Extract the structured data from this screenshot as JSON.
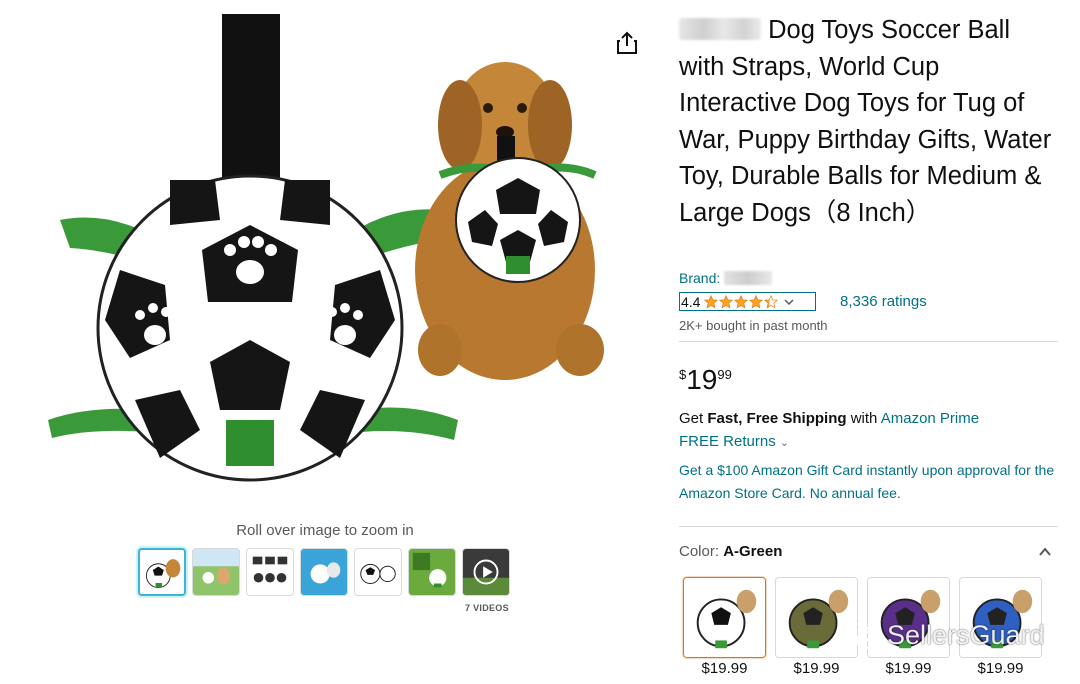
{
  "product": {
    "title": "Dog Toys Soccer Ball with Straps, World Cup Interactive Dog Toys for Tug of War, Puppy Birthday Gifts, Water Toy, Durable Balls for Medium & Large Dogs（8 Inch）",
    "brand_label": "Brand:",
    "rating": {
      "value": "4.4",
      "stars_out_of_5": 4.4,
      "count_label": "8,336 ratings"
    },
    "bought_label": "2K+ bought in past month",
    "price": {
      "symbol": "$",
      "whole": "19",
      "fraction": "99"
    },
    "shipping": {
      "prefix": "Get ",
      "bold": "Fast, Free Shipping",
      "middle": " with ",
      "link": "Amazon Prime"
    },
    "returns_label": "FREE Returns",
    "gift_card_text": "Get a $100 Amazon Gift Card instantly upon approval for the Amazon Store Card. No annual fee.",
    "color": {
      "label": "Color: ",
      "selected": "A-Green"
    },
    "swatches": [
      {
        "name": "A-Green",
        "price": "$19.99",
        "color": "#2f8f2f"
      },
      {
        "name": "Camo",
        "price": "$19.99",
        "color": "#6b6b3a"
      },
      {
        "name": "Purple",
        "price": "$19.99",
        "color": "#5a2f8a"
      },
      {
        "name": "Blue",
        "price": "$19.99",
        "color": "#2f5fc0"
      }
    ]
  },
  "gallery": {
    "zoom_hint": "Roll over image to zoom in",
    "videos_label": "7 VIDEOS",
    "thumbnail_count": 7
  },
  "watermark": "SellersGuard",
  "colors": {
    "link": "#007185",
    "star": "#ffa41c",
    "selected_swatch_border": "#e77600",
    "selected_thumb_border": "#42b0d5",
    "strap_green": "#3a9a3a"
  },
  "icons": {
    "share": "share-icon",
    "collapse": "chevron-up-icon",
    "returns": "chevron-down-icon",
    "play": "play-icon",
    "watermark_logo": "wechat-logo-icon"
  }
}
